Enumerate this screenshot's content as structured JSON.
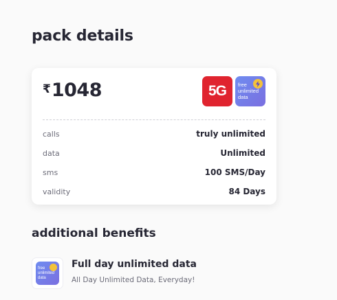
{
  "page": {
    "title": "pack details"
  },
  "pack": {
    "currency": "₹",
    "price": "1048",
    "badge_5g": "5G",
    "badge_data_text": [
      "free",
      "unlimited",
      "data"
    ],
    "details": [
      {
        "label": "calls",
        "value": "truly unlimited"
      },
      {
        "label": "data",
        "value": "Unlimited"
      },
      {
        "label": "sms",
        "value": "100 SMS/Day"
      },
      {
        "label": "validity",
        "value": "84 Days"
      }
    ]
  },
  "additional": {
    "title": "additional benefits",
    "items": [
      {
        "icon": "free-unlimited-data-icon",
        "icon_text": [
          "free",
          "unlimited",
          "data"
        ],
        "title": "Full day unlimited data",
        "description": "All Day Unlimited Data, Everyday!"
      }
    ]
  },
  "colors": {
    "badge_5g": "#e0242f",
    "badge_data": "#7480ea",
    "bolt": "#f3c23a"
  }
}
